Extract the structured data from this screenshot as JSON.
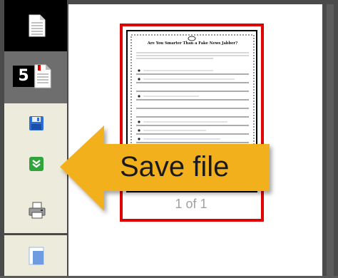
{
  "toolbar": {
    "pages_count": "5"
  },
  "document": {
    "thumbnail_title": "Are You Smarter Than a Fake News Jabber?",
    "page_indicator": "1 of 1"
  },
  "callout": {
    "label": "Save file"
  },
  "colors": {
    "arrow_fill": "#f2b01e",
    "page_outline": "#e00000",
    "save_icon": "#2b6fd6",
    "download_icon": "#2fa43a"
  }
}
